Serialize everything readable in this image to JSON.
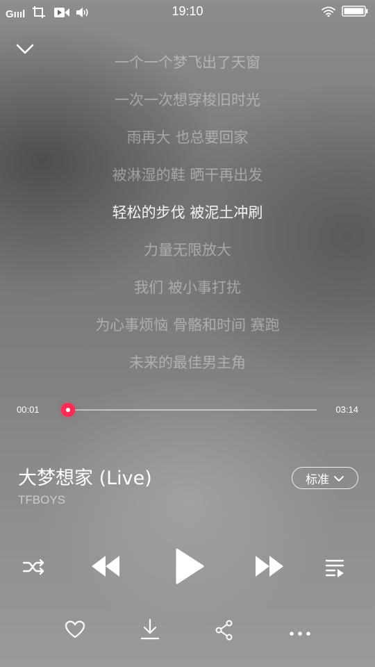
{
  "status_bar": {
    "signal_text": "Gıııl",
    "time": "19:10"
  },
  "lyrics": {
    "lines": [
      "一个一个梦飞出了天窗",
      "一次一次想穿梭旧时光",
      "雨再大 也总要回家",
      "被淋湿的鞋 晒干再出发",
      "轻松的步伐 被泥土冲刷",
      "力量无限放大",
      "我们 被小事打扰",
      "为心事烦恼 骨骼和时间 赛跑",
      "未来的最佳男主角"
    ],
    "active_index": 4
  },
  "player": {
    "current_time": "00:01",
    "total_time": "03:14",
    "progress_fraction": 0.005,
    "accent_color": "#ff2d55"
  },
  "song": {
    "title": "大梦想家 (Live)",
    "artist": "TFBOYS",
    "quality_label": "标准"
  },
  "controls": {
    "icons": [
      "shuffle-icon",
      "previous-icon",
      "play-icon",
      "next-icon",
      "playlist-icon"
    ]
  },
  "actions": {
    "icons": [
      "heart-icon",
      "download-icon",
      "share-icon",
      "more-icon"
    ]
  }
}
